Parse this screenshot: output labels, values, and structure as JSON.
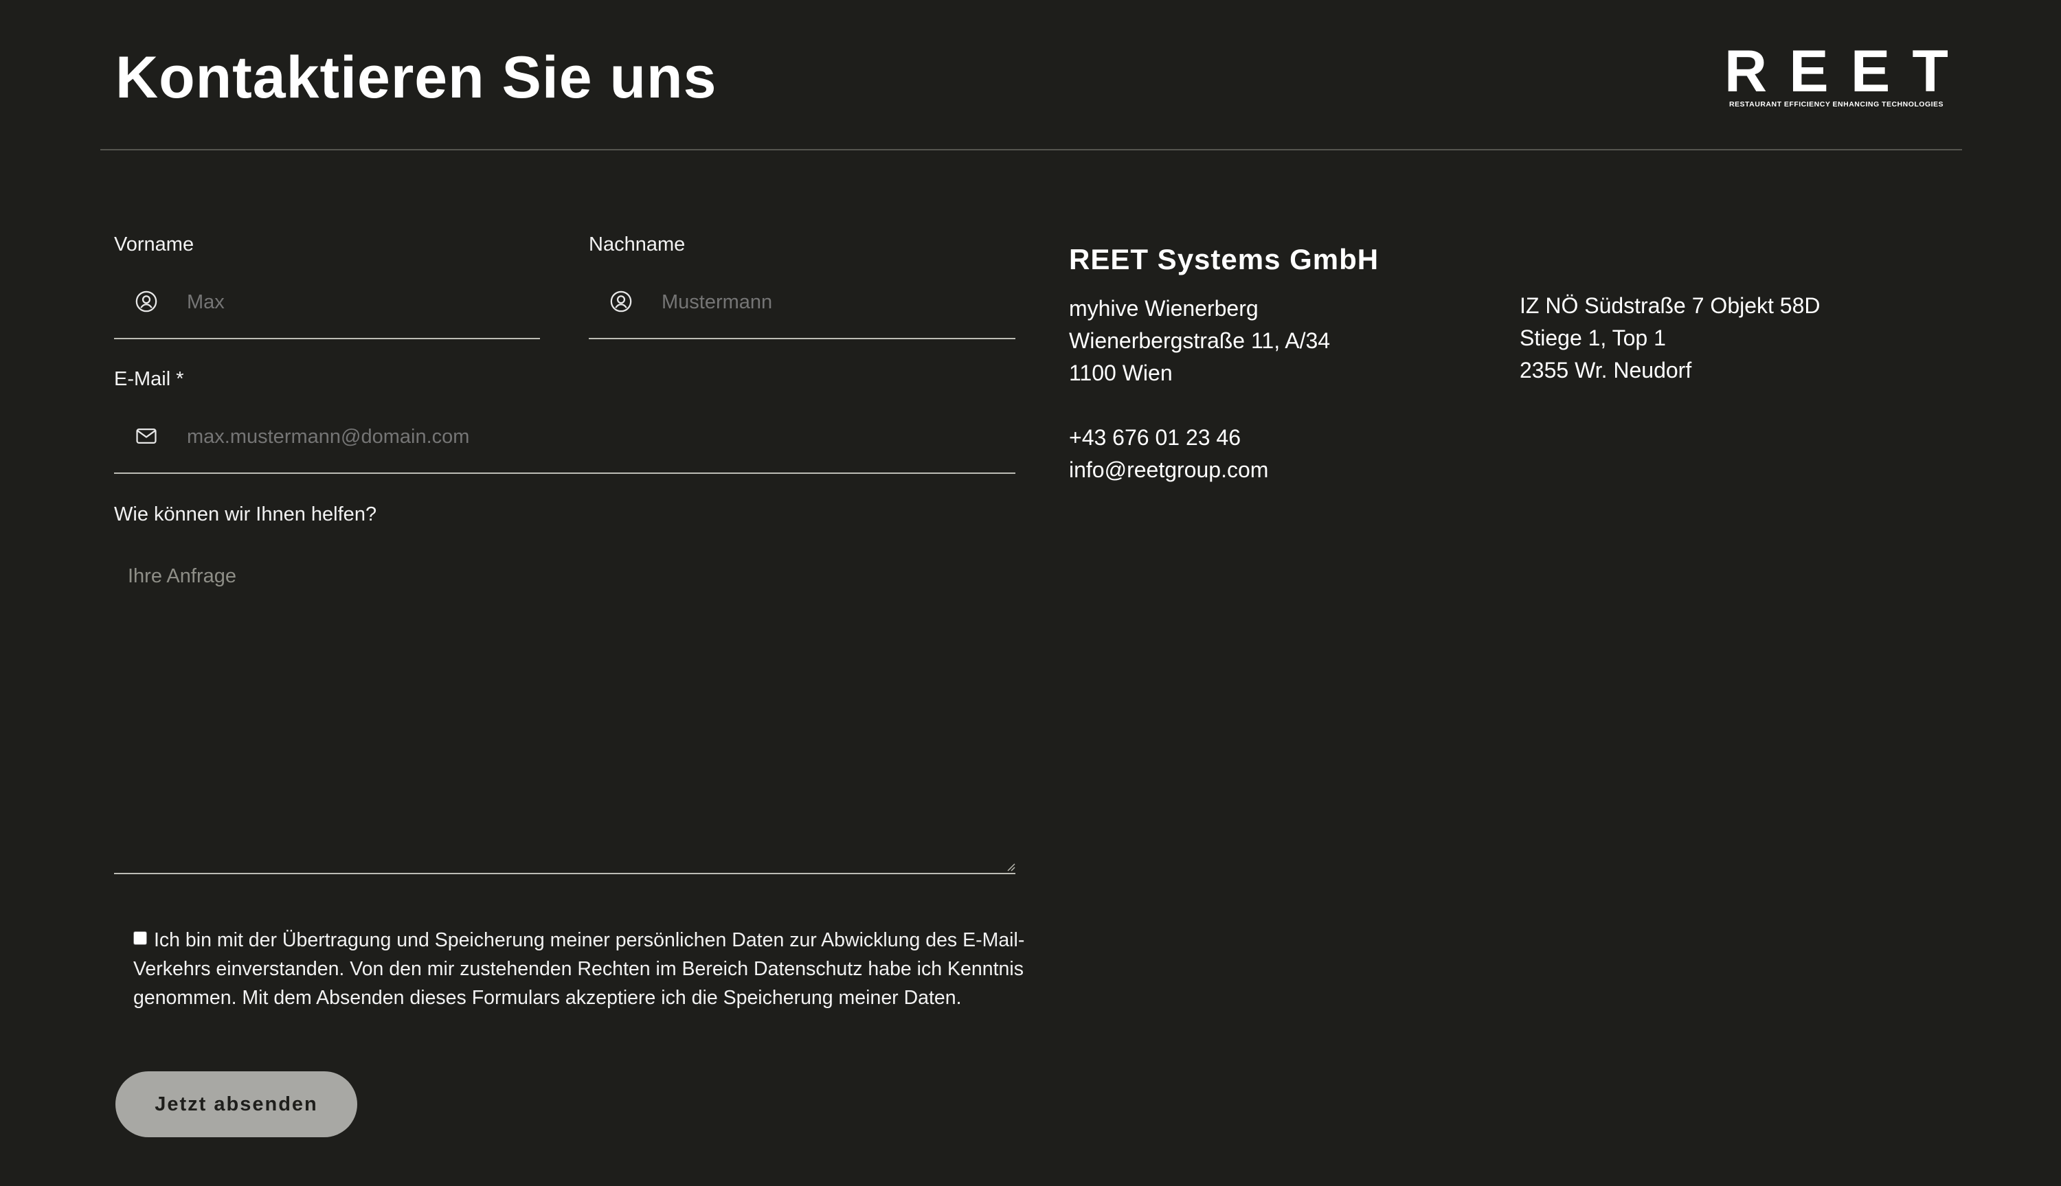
{
  "header": {
    "title": "Kontaktieren Sie uns",
    "logo": {
      "letters": [
        "R",
        "E",
        "E",
        "T"
      ],
      "tagline": "RESTAURANT EFFICIENCY ENHANCING TECHNOLOGIES"
    }
  },
  "form": {
    "first_name": {
      "label": "Vorname",
      "placeholder": "Max",
      "icon": "user-circle-icon"
    },
    "last_name": {
      "label": "Nachname",
      "placeholder": "Mustermann",
      "icon": "user-circle-icon"
    },
    "email": {
      "label": "E-Mail *",
      "placeholder": "max.mustermann@domain.com",
      "icon": "envelope-icon"
    },
    "message": {
      "label": "Wie können wir Ihnen helfen?",
      "placeholder": "Ihre Anfrage"
    },
    "consent": {
      "checked": false,
      "text": "Ich bin mit der Übertragung und Speicherung meiner persönlichen Daten zur Abwicklung des E-Mail-Verkehrs einverstanden. Von den mir zustehenden Rechten im Bereich Datenschutz habe ich Kenntnis genommen. Mit dem Absenden dieses Formulars akzeptiere ich die Speicherung meiner Daten."
    },
    "submit_label": "Jetzt absenden"
  },
  "company": {
    "name": "REET Systems GmbH",
    "location_1": {
      "line1": "myhive Wienerberg",
      "line2": "Wienerbergstraße 11, A/34",
      "line3": "1100 Wien"
    },
    "phone": "+43 676 01 23 46",
    "email": "info@reetgroup.com",
    "location_2": {
      "line1": "IZ NÖ Südstraße 7 Objekt 58D",
      "line2": "Stiege 1, Top 1",
      "line3": "2355 Wr. Neudorf"
    }
  },
  "colors": {
    "background": "#1e1e1b",
    "text": "#ffffff",
    "placeholder": "#8e8e87",
    "button_bg": "#a8a8a4",
    "underline": "#bdbdb6"
  }
}
